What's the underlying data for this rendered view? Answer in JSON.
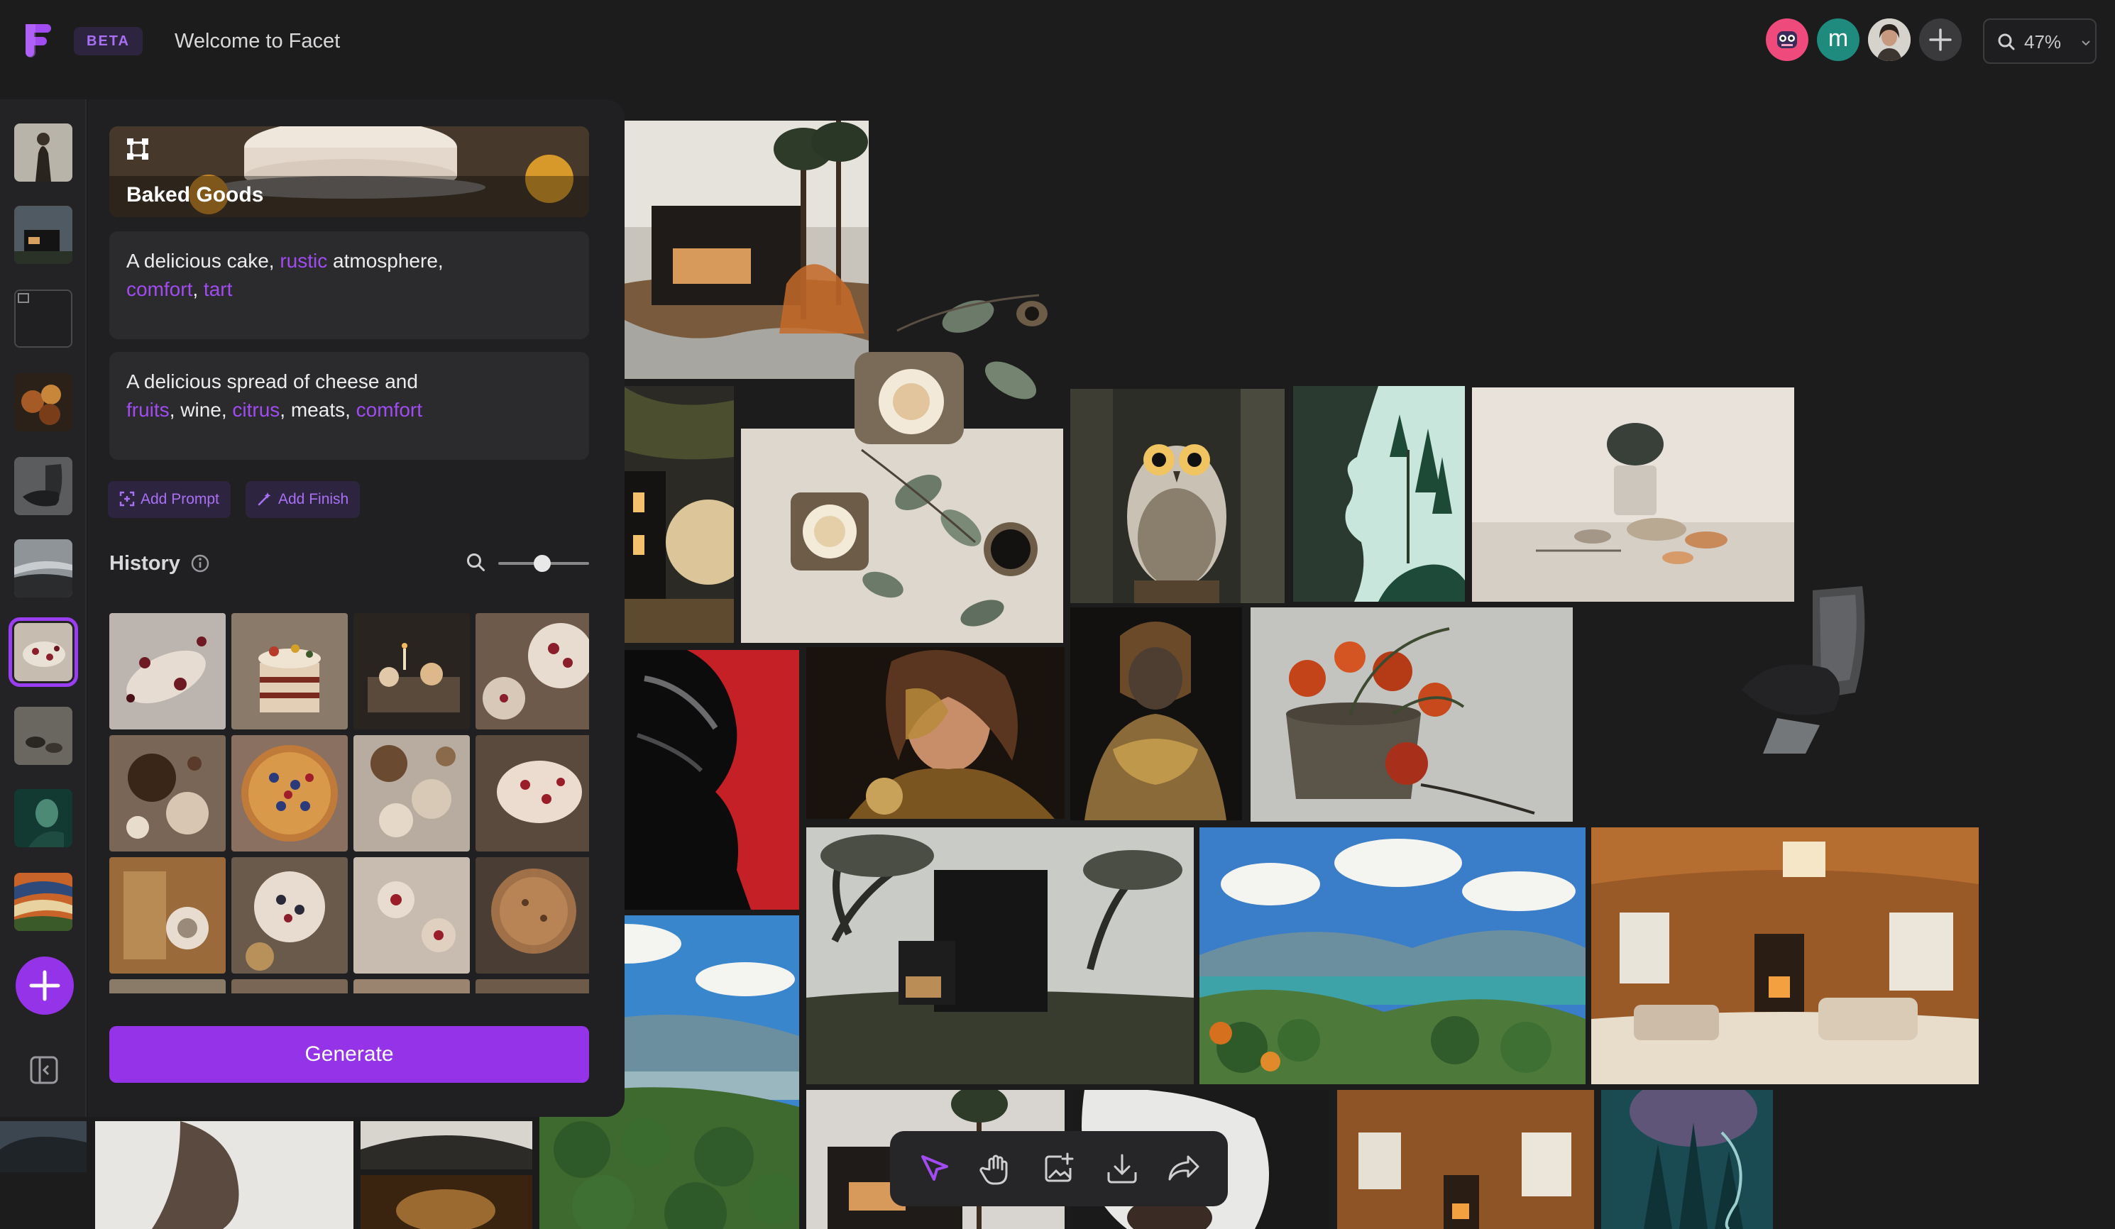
{
  "app": {
    "badge": "BETA",
    "title": "Welcome to Facet",
    "logo_icon": "facet-logo-icon",
    "accent": "#9433e8"
  },
  "header": {
    "avatars": [
      {
        "name": "avatar-pink",
        "color": "#ee4a7c"
      },
      {
        "name": "avatar-m",
        "initial": "m",
        "color": "#1f8a7e"
      },
      {
        "name": "avatar-photo",
        "color": "#c9c2bb"
      }
    ],
    "add_icon": "plus-icon",
    "zoom": {
      "icon": "search-icon",
      "value": "47%",
      "dropdown_icon": "chevron-down-icon"
    }
  },
  "panel": {
    "workspace_title": "Baked Goods",
    "workspace_icon": "frame-icon",
    "prompts": [
      {
        "parts": [
          {
            "t": "A delicious cake, ",
            "hl": false
          },
          {
            "t": "rustic",
            "hl": true
          },
          {
            "t": " atmosphere, ",
            "hl": false
          },
          {
            "t": "comfort",
            "hl": true
          },
          {
            "t": ", ",
            "hl": false
          },
          {
            "t": "tart",
            "hl": true
          }
        ]
      },
      {
        "parts": [
          {
            "t": "A delicious spread of cheese and ",
            "hl": false
          },
          {
            "t": "fruits",
            "hl": true
          },
          {
            "t": ", wine, ",
            "hl": false
          },
          {
            "t": "citrus",
            "hl": true
          },
          {
            "t": ", meats, ",
            "hl": false
          },
          {
            "t": "comfort",
            "hl": true
          }
        ]
      }
    ],
    "add_prompt": "Add Prompt",
    "add_finish": "Add Finish",
    "history_title": "History",
    "history_info_icon": "info-icon",
    "history_search_icon": "search-icon",
    "history_thumb_size": 0.4,
    "generate": "Generate"
  },
  "rail": {
    "items": [
      "armor-figure",
      "black-house",
      "broken-image",
      "fruit-still-life",
      "chair",
      "foggy-landscape",
      "baked-goods",
      "desert-dogs",
      "green-portrait",
      "colorful-landscape"
    ],
    "active_index": 6,
    "add_icon": "plus-icon",
    "collapse_icon": "sidebar-collapse-icon"
  },
  "toolbar": {
    "tools": [
      "select-arrow-icon",
      "hand-pan-icon",
      "add-image-icon",
      "download-icon",
      "share-icon"
    ],
    "active_index": 0
  }
}
